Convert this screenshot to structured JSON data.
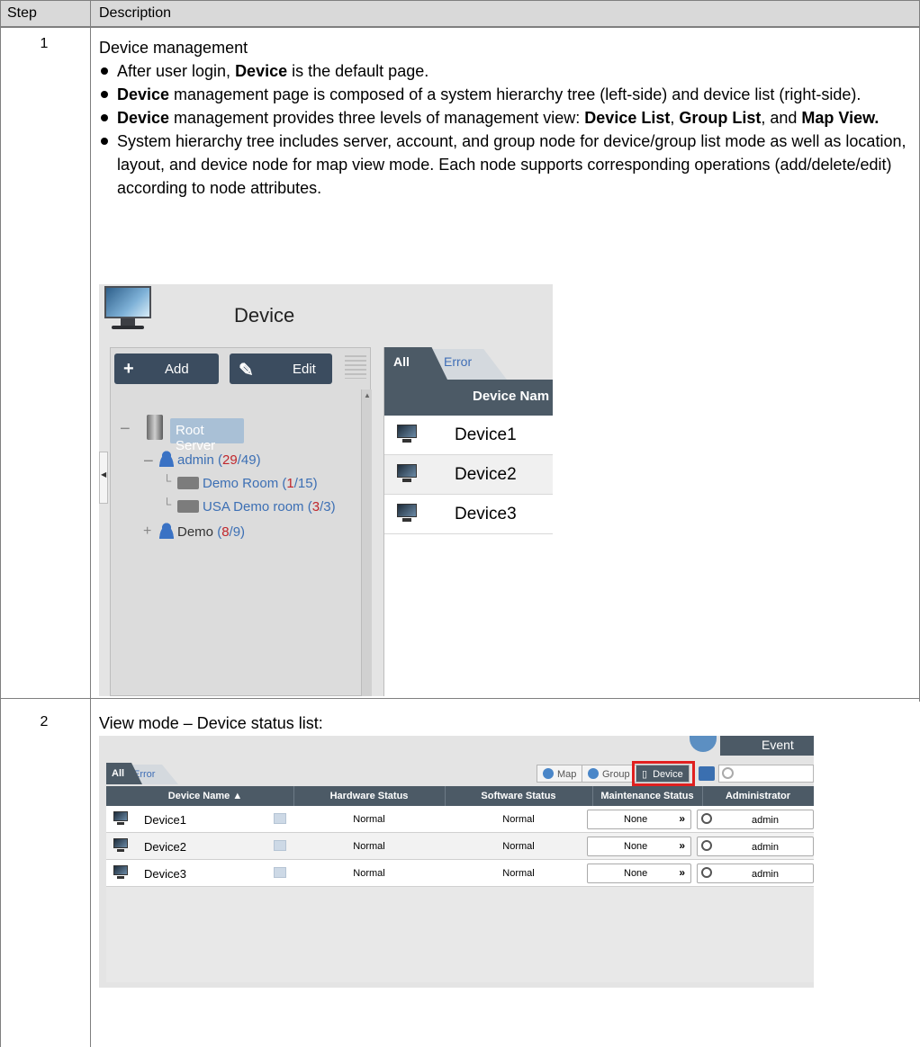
{
  "table": {
    "header_step": "Step",
    "header_description": "Description"
  },
  "row1": {
    "step": "1",
    "title": "Device management",
    "bullets": [
      {
        "pre": "After user login, ",
        "b1": "Device",
        "post": " is the default page."
      },
      {
        "b1": "Device",
        "post": " management page is composed of a system hierarchy tree (left-side) and device list (right-side)."
      },
      {
        "b1": "Device",
        "mid": " management provides three levels of management view: ",
        "b2": "Device List",
        "sep": ", ",
        "b3": "Group List",
        "and": ", and ",
        "b4": "Map View."
      },
      {
        "post": "System hierarchy tree includes server, account, and group node for device/group list mode as well as location, layout, and device node for map view mode. Each node supports corresponding operations (add/delete/edit) according to node attributes."
      }
    ],
    "shot": {
      "title": "Device",
      "add_label": "Add",
      "edit_label": "Edit",
      "tree": {
        "server": "Root Server",
        "admin_name": "admin",
        "admin_open": "(",
        "admin_red": "29",
        "admin_rest": "/49)",
        "room1_name": "Demo Room",
        "room1_open": "(",
        "room1_red": "1",
        "room1_rest": "/15)",
        "room2_name": "USA Demo room",
        "room2_open": "(",
        "room2_red": "3",
        "room2_rest": "/3)",
        "demo_name": "Demo",
        "demo_open": "(",
        "demo_red": "8",
        "demo_rest": "/9)"
      },
      "tab_all": "All",
      "tab_error": "Error",
      "column_header": "Device Nam",
      "devices": [
        "Device1",
        "Device2",
        "Device3"
      ]
    }
  },
  "row2": {
    "step": "2",
    "text": "View mode – Device status list:",
    "shot": {
      "event": "Event",
      "tab_all": "All",
      "tab_error": "Error",
      "btn_map": "Map",
      "btn_group": "Group",
      "btn_device": "Device",
      "columns": [
        "Device Name ▲",
        "Hardware Status",
        "Software Status",
        "Maintenance Status",
        "Administrator"
      ],
      "rows": [
        {
          "name": "Device1",
          "hw": "Normal",
          "sw": "Normal",
          "maint": "None",
          "admin": "admin"
        },
        {
          "name": "Device2",
          "hw": "Normal",
          "sw": "Normal",
          "maint": "None",
          "admin": "admin"
        },
        {
          "name": "Device3",
          "hw": "Normal",
          "sw": "Normal",
          "maint": "None",
          "admin": "admin"
        }
      ]
    }
  },
  "colors": {
    "header_bg": "#d9d9d9",
    "dark_ui": "#4c5a66",
    "link_blue": "#3c6fb4",
    "count_red": "#c0262c",
    "highlight_red": "#e02020"
  }
}
